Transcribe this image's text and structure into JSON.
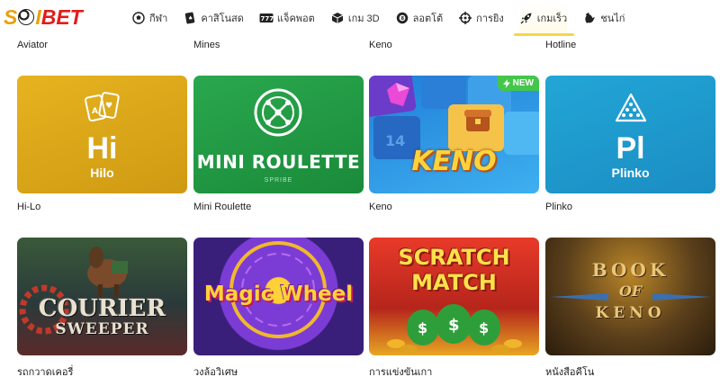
{
  "brand": {
    "logo_part1": "S",
    "logo_part2": "I",
    "logo_part3": "BET"
  },
  "nav": [
    {
      "label": "กีฬา",
      "icon": "soccer-ball-icon"
    },
    {
      "label": "คาสิโนสด",
      "icon": "playing-card-icon"
    },
    {
      "label": "แจ็คพอต",
      "icon": "slot-777-icon"
    },
    {
      "label": "เกม 3D",
      "icon": "cube-3d-icon"
    },
    {
      "label": "ลอตโต้",
      "icon": "lotto-ball-icon"
    },
    {
      "label": "การยิง",
      "icon": "crosshair-icon"
    },
    {
      "label": "เกมเร็ว",
      "icon": "rocket-icon",
      "active": true
    },
    {
      "label": "ชนไก่",
      "icon": "rooster-icon"
    }
  ],
  "top_labels": [
    "Aviator",
    "Mines",
    "Keno",
    "Hotline"
  ],
  "row1": [
    {
      "label": "Hi-Lo",
      "symbol": "Hi",
      "subtitle": "Hilo"
    },
    {
      "label": "Mini Roulette",
      "art_title": "MINI ROULETTE",
      "provider": "SPRIBE"
    },
    {
      "label": "Keno",
      "art_title": "KENO",
      "badge": "NEW"
    },
    {
      "label": "Plinko",
      "symbol": "Pl",
      "subtitle": "Plinko"
    }
  ],
  "row2": [
    {
      "label": "รถกวาดเคอรี่",
      "art_title_1": "COURIER",
      "art_title_2": "SWEEPER"
    },
    {
      "label": "วงล้อวิเศษ",
      "art_title": "Magic Wheel"
    },
    {
      "label": "การแข่งขันเกา",
      "art_title_1": "SCRATCH",
      "art_title_2": "MATCH"
    },
    {
      "label": "หนังสือคีโน",
      "art_title_1": "BOOK",
      "art_title_2": "OF",
      "art_title_3": "KENO"
    }
  ],
  "colors": {
    "active_underline": "#f3d74a",
    "new_badge": "#43c64a",
    "hilo_bg": "#e6b320",
    "mini_roulette_bg": "#2aa84e",
    "plinko_bg": "#22a6d6"
  }
}
